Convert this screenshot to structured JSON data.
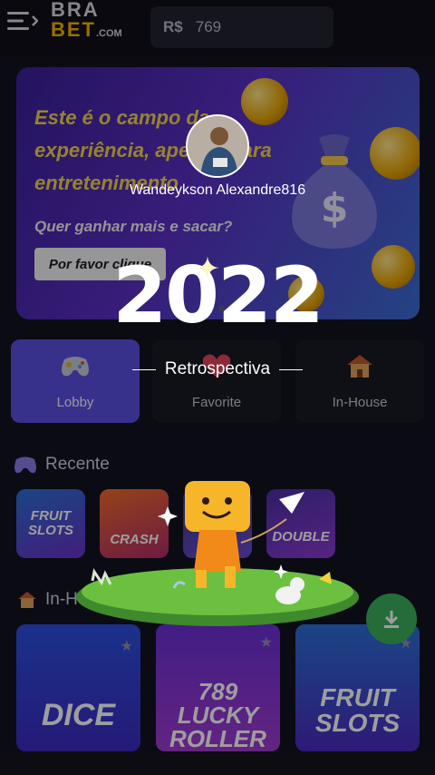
{
  "header": {
    "logo_top": "BRA",
    "logo_bottom": "BET",
    "logo_suffix": ".COM",
    "currency": "R$",
    "balance": "769"
  },
  "banner": {
    "title": "Este é o campo da experiência, apenas para entretenimento",
    "subtitle": "Quer ganhar mais e sacar?",
    "button_label": "Por favor clique"
  },
  "tabs": [
    {
      "label": "Lobby",
      "icon": "gamepad-icon",
      "active": true
    },
    {
      "label": "Favorite",
      "icon": "heart-icon",
      "active": false
    },
    {
      "label": "In-House",
      "icon": "house-icon",
      "active": false
    }
  ],
  "recent": {
    "title": "Recente",
    "games": [
      "FRUIT SLOTS",
      "CRASH",
      "",
      "DOUBLE"
    ]
  },
  "inhouse": {
    "title": "In-H",
    "games": [
      "DICE",
      "789 LUCKY ROLLER",
      "FRUIT SLOTS"
    ]
  },
  "overlay": {
    "username": "Wandeykson Alexandre816",
    "year": "2022",
    "subtitle": "Retrospectiva"
  },
  "colors": {
    "accent": "#5b4fe0",
    "brand_yellow": "#f5b400",
    "download_green": "#3bb05a"
  }
}
